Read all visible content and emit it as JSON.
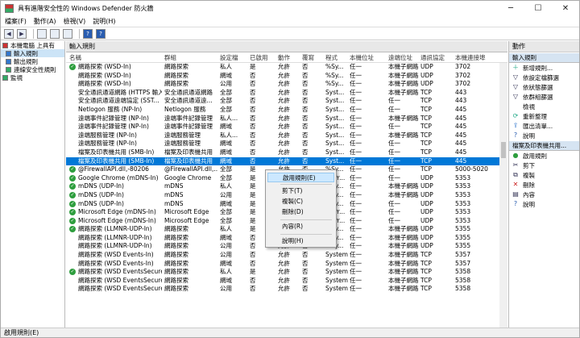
{
  "window": {
    "title": "具有進階安全性的 Windows Defender 防火牆",
    "min": "─",
    "max": "☐",
    "close": "✕"
  },
  "menu": [
    "檔案(F)",
    "動作(A)",
    "檢視(V)",
    "說明(H)"
  ],
  "toolbar": {
    "back": "◀",
    "forward": "▶",
    "help1": "?",
    "help2": "?"
  },
  "tree": {
    "root": "本機電腦 上具有",
    "items": [
      "輸入規則",
      "輸出規則",
      "連線安全性規則",
      "監視"
    ]
  },
  "center": {
    "header": "輸入規則",
    "columns": [
      "名稱",
      "群組",
      "設定檔",
      "已啟用",
      "動作",
      "覆寫",
      "程式",
      "本機位址",
      "遠端位址",
      "通訊協定",
      "本機連接埠"
    ],
    "rows": [
      [
        "網路探索 (WSD-In)",
        "網路探索",
        "私人",
        "是",
        "允許",
        "否",
        "%Sy...",
        "任一",
        "本機子網路",
        "UDP",
        "3702"
      ],
      [
        "網路探索 (WSD-In)",
        "網路探索",
        "網域",
        "否",
        "允許",
        "否",
        "%Sy...",
        "任一",
        "本機子網路",
        "UDP",
        "3702"
      ],
      [
        "網路探索 (WSD-In)",
        "網路探索",
        "公用",
        "否",
        "允許",
        "否",
        "%Sy...",
        "任一",
        "本機子網路",
        "UDP",
        "3702"
      ],
      [
        "安全通訊通道網路 (HTTPS 輸入...",
        "安全通訊通道網路",
        "全部",
        "否",
        "允許",
        "否",
        "Syst...",
        "任一",
        "本機子網路",
        "TCP",
        "443"
      ],
      [
        "安全通訊通道遠端協定 (SST...",
        "安全通訊通道遠...",
        "全部",
        "否",
        "允許",
        "否",
        "Syst...",
        "任一",
        "任一",
        "TCP",
        "443"
      ],
      [
        "Netlogon 服務 (NP-In)",
        "Netlogon 服務",
        "全部",
        "否",
        "允許",
        "否",
        "Syst...",
        "任一",
        "任一",
        "TCP",
        "445"
      ],
      [
        "遠端事件記錄管理 (NP-In)",
        "遠端事件記錄管理",
        "私人...",
        "否",
        "允許",
        "否",
        "Syst...",
        "任一",
        "本機子網路",
        "TCP",
        "445"
      ],
      [
        "遠端事件記錄管理 (NP-In)",
        "遠端事件記錄管理",
        "網域",
        "否",
        "允許",
        "否",
        "Syst...",
        "任一",
        "任一",
        "TCP",
        "445"
      ],
      [
        "遠端服務管理 (NP-In)",
        "遠端服務管理",
        "私人...",
        "否",
        "允許",
        "否",
        "Syst...",
        "任一",
        "本機子網路",
        "TCP",
        "445"
      ],
      [
        "遠端服務管理 (NP-In)",
        "遠端服務管理",
        "網域",
        "否",
        "允許",
        "否",
        "Syst...",
        "任一",
        "任一",
        "TCP",
        "445"
      ],
      [
        "檔案及印表機共用 (SMB-In)",
        "檔案及印表機共用",
        "網域",
        "否",
        "允許",
        "否",
        "Syst...",
        "任一",
        "任一",
        "TCP",
        "445"
      ],
      [
        "檔案及印表機共用 (SMB-In)",
        "檔案及印表機共用",
        "網域",
        "否",
        "允許",
        "否",
        "Syst...",
        "任一",
        "任一",
        "TCP",
        "445"
      ],
      [
        "@FirewallAPI.dll,-80206",
        "@FirewallAPI.dll,...",
        "全部",
        "是",
        "允許",
        "否",
        "%Sy...",
        "任一",
        "任一",
        "TCP",
        "5000-5020"
      ],
      [
        "Google Chrome (mDNS-In)",
        "Google Chrome",
        "全部",
        "是",
        "允許",
        "否",
        "C:\\Pr...",
        "任一",
        "任一",
        "UDP",
        "5353"
      ],
      [
        "mDNS (UDP-In)",
        "mDNS",
        "私人",
        "是",
        "允許",
        "否",
        "%Sy...",
        "任一",
        "本機子網路",
        "UDP",
        "5353"
      ],
      [
        "mDNS (UDP-In)",
        "mDNS",
        "公用",
        "是",
        "允許",
        "否",
        "%Sy...",
        "任一",
        "本機子網路",
        "UDP",
        "5353"
      ],
      [
        "mDNS (UDP-In)",
        "mDNS",
        "網域",
        "是",
        "允許",
        "否",
        "%Sy...",
        "任一",
        "任一",
        "UDP",
        "5353"
      ],
      [
        "Microsoft Edge (mDNS-In)",
        "Microsoft Edge",
        "全部",
        "是",
        "允許",
        "否",
        "C:\\Pr...",
        "任一",
        "任一",
        "UDP",
        "5353"
      ],
      [
        "Microsoft Edge (mDNS-In)",
        "Microsoft Edge",
        "全部",
        "是",
        "允許",
        "否",
        "C:\\Pr...",
        "任一",
        "任一",
        "UDP",
        "5353"
      ],
      [
        "網路探索 (LLMNR-UDP-In)",
        "網路探索",
        "私人",
        "是",
        "允許",
        "否",
        "%Sy...",
        "任一",
        "本機子網路",
        "UDP",
        "5355"
      ],
      [
        "網路探索 (LLMNR-UDP-In)",
        "網路探索",
        "網域",
        "否",
        "允許",
        "否",
        "%Sy...",
        "任一",
        "本機子網路",
        "UDP",
        "5355"
      ],
      [
        "網路探索 (LLMNR-UDP-In)",
        "網路探索",
        "公用",
        "否",
        "允許",
        "否",
        "%Sy...",
        "任一",
        "本機子網路",
        "UDP",
        "5355"
      ],
      [
        "網路探索 (WSD Events-In)",
        "網路探索",
        "公用",
        "否",
        "允許",
        "否",
        "System",
        "任一",
        "本機子網路",
        "TCP",
        "5357"
      ],
      [
        "網路探索 (WSD Events-In)",
        "網路探索",
        "網域",
        "否",
        "允許",
        "否",
        "System",
        "任一",
        "本機子網路",
        "TCP",
        "5357"
      ],
      [
        "網路探索 (WSD EventsSecure...",
        "網路探索",
        "私人",
        "是",
        "允許",
        "否",
        "System",
        "任一",
        "本機子網路",
        "TCP",
        "5358"
      ],
      [
        "網路探索 (WSD EventsSecure...",
        "網路探索",
        "網域",
        "否",
        "允許",
        "否",
        "System",
        "任一",
        "本機子網路",
        "TCP",
        "5358"
      ],
      [
        "網路探索 (WSD EventsSecure...",
        "網路探索",
        "公用",
        "否",
        "允許",
        "否",
        "System",
        "任一",
        "本機子網路",
        "TCP",
        "5358"
      ]
    ],
    "selected_row": 11,
    "enabled_rows": [
      0,
      12,
      13,
      14,
      15,
      16,
      17,
      18,
      19,
      24
    ]
  },
  "context_menu": {
    "items": [
      "啟用規則(E)",
      "剪下(T)",
      "複製(C)",
      "刪除(D)",
      "內容(R)",
      "說明(H)"
    ]
  },
  "actions": {
    "header": "動作",
    "section1": "輸入規則",
    "section1_items": [
      "新增規則...",
      "依設定檔篩選",
      "依狀態篩選",
      "依群組篩選",
      "檢視",
      "重新整理",
      "匯出清單...",
      "說明"
    ],
    "section2": "檔案及印表機共用...",
    "section2_items": [
      "啟用規則",
      "剪下",
      "複製",
      "刪除",
      "內容",
      "說明"
    ]
  },
  "status": "啟用規則(E)",
  "colors": {
    "selection": "#0078d7",
    "check": "#2e9e3e"
  }
}
